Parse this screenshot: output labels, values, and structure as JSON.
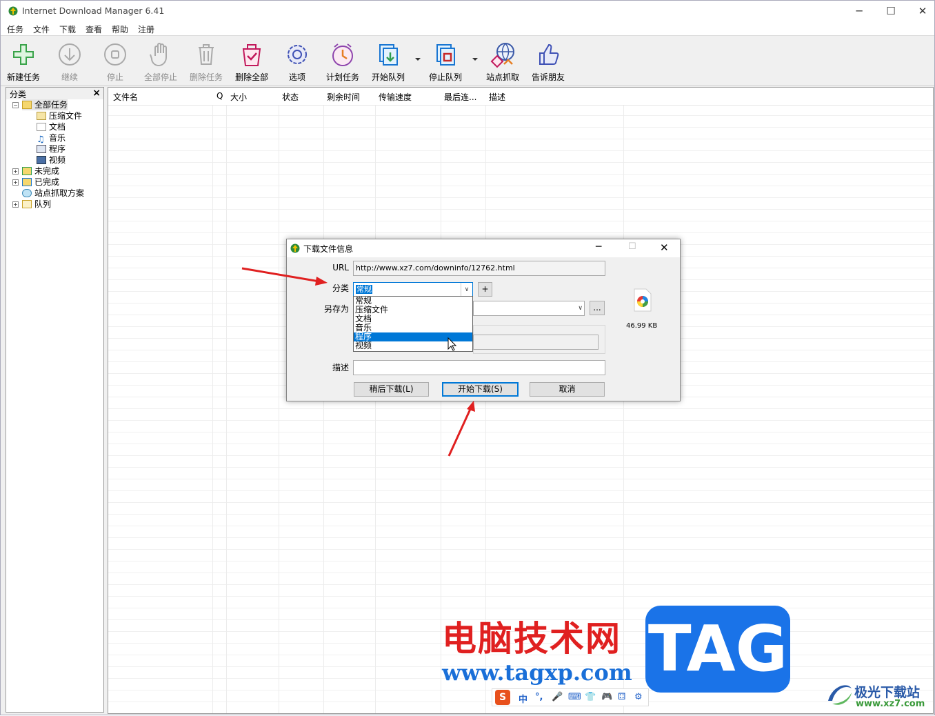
{
  "window": {
    "title": "Internet Download Manager 6.41"
  },
  "menu": [
    "任务",
    "文件",
    "下载",
    "查看",
    "帮助",
    "注册"
  ],
  "toolbar": [
    {
      "label": "新建任务",
      "icon": "add-icon",
      "enabled": true
    },
    {
      "label": "继续",
      "icon": "resume-icon",
      "enabled": false
    },
    {
      "label": "停止",
      "icon": "stop-icon",
      "enabled": false
    },
    {
      "label": "全部停止",
      "icon": "stop-all-icon",
      "enabled": false
    },
    {
      "label": "删除任务",
      "icon": "trash-icon",
      "enabled": false
    },
    {
      "label": "删除全部",
      "icon": "delete-all-icon",
      "enabled": true
    },
    {
      "label": "选项",
      "icon": "gear-icon",
      "enabled": true
    },
    {
      "label": "计划任务",
      "icon": "clock-icon",
      "enabled": true
    },
    {
      "label": "开始队列",
      "icon": "start-queue-icon",
      "enabled": true
    },
    {
      "label": "停止队列",
      "icon": "stop-queue-icon",
      "enabled": true
    },
    {
      "label": "站点抓取",
      "icon": "site-grabber-icon",
      "enabled": true
    },
    {
      "label": "告诉朋友",
      "icon": "thumbs-up-icon",
      "enabled": true
    }
  ],
  "sidebar": {
    "title": "分类",
    "close": "×",
    "tree": [
      {
        "label": "全部任务",
        "icon": "folder-open-icon",
        "level": 0,
        "expander": "−"
      },
      {
        "label": "压缩文件",
        "icon": "archive-icon",
        "level": 1
      },
      {
        "label": "文档",
        "icon": "document-icon",
        "level": 1
      },
      {
        "label": "音乐",
        "icon": "music-icon",
        "level": 1
      },
      {
        "label": "程序",
        "icon": "program-icon",
        "level": 1
      },
      {
        "label": "视频",
        "icon": "video-icon",
        "level": 1
      },
      {
        "label": "未完成",
        "icon": "folder-incomplete-icon",
        "level": 0,
        "expander": "+"
      },
      {
        "label": "已完成",
        "icon": "folder-complete-icon",
        "level": 0,
        "expander": "+"
      },
      {
        "label": "站点抓取方案",
        "icon": "grabber-project-icon",
        "level": 0
      },
      {
        "label": "队列",
        "icon": "folder-queue-icon",
        "level": 0,
        "expander": "+"
      }
    ]
  },
  "columns": [
    "文件名",
    "Q",
    "大小",
    "状态",
    "剩余时间",
    "传输速度",
    "最后连...",
    "描述"
  ],
  "dialog": {
    "title": "下载文件信息",
    "url_label": "URL",
    "url": "http://www.xz7.com/downinfo/12762.html",
    "category_label": "分类",
    "category_value": "常规",
    "add_label": "+",
    "save_as_label": "另存为",
    "browse_label": "...",
    "desc_label": "描述",
    "file_size": "46.99 KB",
    "dropdown": [
      "常规",
      "压缩文件",
      "文档",
      "音乐",
      "程序",
      "视频"
    ],
    "dropdown_selected": 4,
    "buttons": {
      "later": "稍后下载(L)",
      "start": "开始下载(S)",
      "cancel": "取消"
    }
  },
  "watermark": {
    "line1": "电脑技术网",
    "line2": "www.tagxp.com",
    "tag": "TAG",
    "brand": "极光下载站",
    "brand_url": "www.xz7.com"
  },
  "ime": [
    "中",
    "°,",
    "🎤",
    "⌨",
    "👕",
    "🎮",
    "⚃",
    "⚙"
  ]
}
